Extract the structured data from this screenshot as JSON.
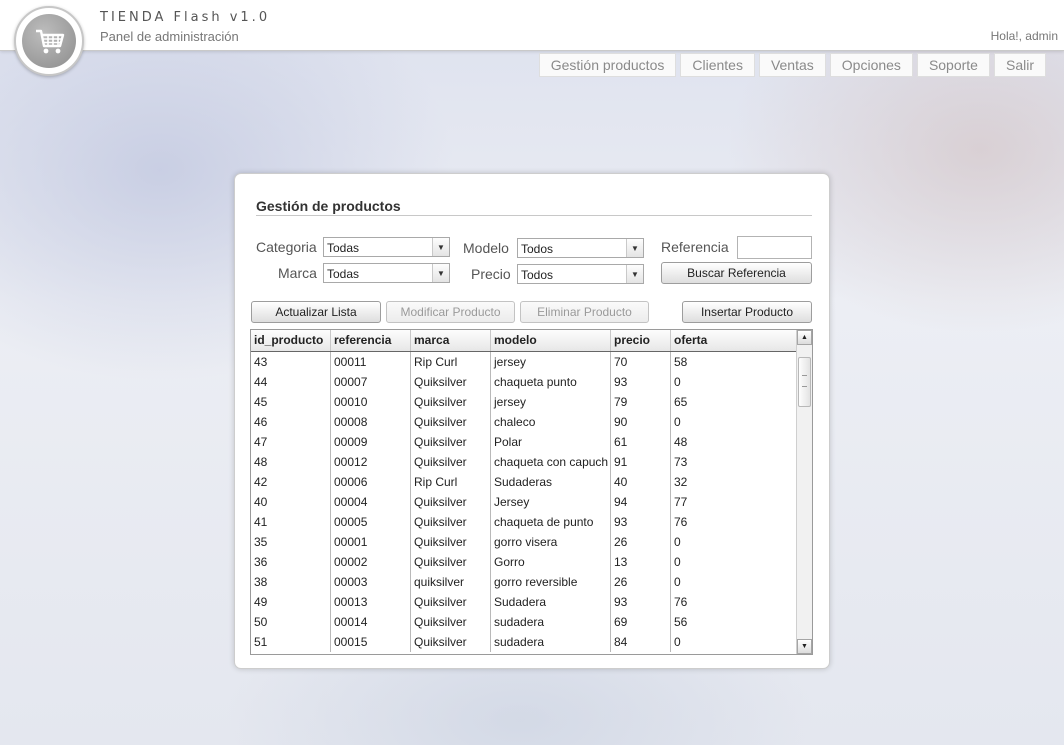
{
  "header": {
    "title": "TIENDA Flash v1.0",
    "subtitle": "Panel de administración",
    "greeting": "Hola!, admin",
    "logo_icon": "shopping-cart-icon"
  },
  "nav": [
    {
      "label": "Gestión productos"
    },
    {
      "label": "Clientes"
    },
    {
      "label": "Ventas"
    },
    {
      "label": "Opciones"
    },
    {
      "label": "Soporte"
    },
    {
      "label": "Salir"
    }
  ],
  "panel": {
    "title": "Gestión de productos",
    "filters": {
      "categoria_label": "Categoria",
      "categoria_value": "Todas",
      "marca_label": "Marca",
      "marca_value": "Todas",
      "modelo_label": "Modelo",
      "modelo_value": "Todos",
      "precio_label": "Precio",
      "precio_value": "Todos",
      "referencia_label": "Referencia",
      "referencia_value": "",
      "buscar_label": "Buscar Referencia"
    },
    "actions": {
      "actualizar": "Actualizar Lista",
      "modificar": "Modificar Producto",
      "eliminar": "Eliminar Producto",
      "insertar": "Insertar Producto"
    },
    "table": {
      "columns": [
        "id_producto",
        "referencia",
        "marca",
        "modelo",
        "precio",
        "oferta"
      ],
      "rows": [
        [
          "43",
          "00011",
          "Rip Curl",
          "jersey",
          "70",
          "58"
        ],
        [
          "44",
          "00007",
          "Quiksilver",
          "chaqueta punto",
          "93",
          "0"
        ],
        [
          "45",
          "00010",
          "Quiksilver",
          "jersey",
          "79",
          "65"
        ],
        [
          "46",
          "00008",
          "Quiksilver",
          "chaleco",
          "90",
          "0"
        ],
        [
          "47",
          "00009",
          "Quiksilver",
          "Polar",
          "61",
          "48"
        ],
        [
          "48",
          "00012",
          "Quiksilver",
          "chaqueta con capuch",
          "91",
          "73"
        ],
        [
          "42",
          "00006",
          "Rip Curl",
          "Sudaderas",
          "40",
          "32"
        ],
        [
          "40",
          "00004",
          "Quiksilver",
          "Jersey",
          "94",
          "77"
        ],
        [
          "41",
          "00005",
          "Quiksilver",
          "chaqueta de punto",
          "93",
          "76"
        ],
        [
          "35",
          "00001",
          "Quiksilver",
          "gorro visera",
          "26",
          "0"
        ],
        [
          "36",
          "00002",
          "Quiksilver",
          "Gorro",
          "13",
          "0"
        ],
        [
          "38",
          "00003",
          "quiksilver",
          "gorro reversible",
          "26",
          "0"
        ],
        [
          "49",
          "00013",
          "Quiksilver",
          "Sudadera",
          "93",
          "76"
        ],
        [
          "50",
          "00014",
          "Quiksilver",
          "sudadera",
          "69",
          "56"
        ],
        [
          "51",
          "00015",
          "Quiksilver",
          "sudadera",
          "84",
          "0"
        ]
      ]
    }
  },
  "icons": {
    "dropdown": "chevron-down-icon",
    "scroll_up": "arrow-up-icon",
    "scroll_down": "arrow-down-icon"
  }
}
